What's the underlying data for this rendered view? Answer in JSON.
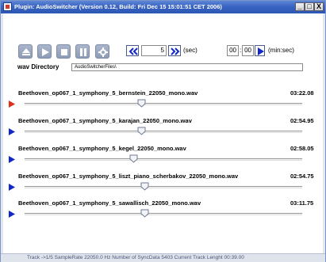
{
  "window": {
    "title": "Plugin: AudioSwitcher (Version 0.12, Build: Fri Dec 15 15:01:51 CET 2006)",
    "minimize_glyph": "_",
    "maximize_glyph": "□",
    "close_glyph": "X"
  },
  "toolbar": {
    "buttons": [
      "eject-icon",
      "play-icon",
      "stop-icon",
      "pause-icon",
      "settings-icon"
    ],
    "seek_seconds": "5",
    "seek_unit": "(sec)",
    "jump_min": "00",
    "jump_sec": "00",
    "jump_unit": "(min:sec)",
    "directory_label": "wav Directory",
    "directory_value": "AudioSwitcherFiles\\"
  },
  "tracks": [
    {
      "name": "Beethoven_op067_1_symphony_5_bernstein_22050_mono.wav",
      "duration": "03:22.08",
      "position": 0.42,
      "active": true
    },
    {
      "name": "Beethoven_op067_1_symphony_5_karajan_22050_mono.wav",
      "duration": "02:54.95",
      "position": 0.42,
      "active": false
    },
    {
      "name": "Beethoven_op067_1_symphony_5_kegel_22050_mono.wav",
      "duration": "02:58.05",
      "position": 0.39,
      "active": false
    },
    {
      "name": "Beethoven_op067_1_symphony_5_liszt_piano_scherbakov_22050_mono.wav",
      "duration": "02:54.75",
      "position": 0.43,
      "active": false
    },
    {
      "name": "Beethoven_op067_1_symphony_5_sawallisch_22050_mono.wav",
      "duration": "03:11.75",
      "position": 0.43,
      "active": false
    }
  ],
  "status": {
    "text": "Track ->1/5  SampleRate  22050.0 Hz   Number of SyncData  5403   Current Track Lenght  00:39.00"
  },
  "colors": {
    "titlebar": "#3a64c2",
    "active_play": "#e0301c",
    "inactive_play": "#1028c8",
    "toolbar_button": "#9aa8c2"
  }
}
